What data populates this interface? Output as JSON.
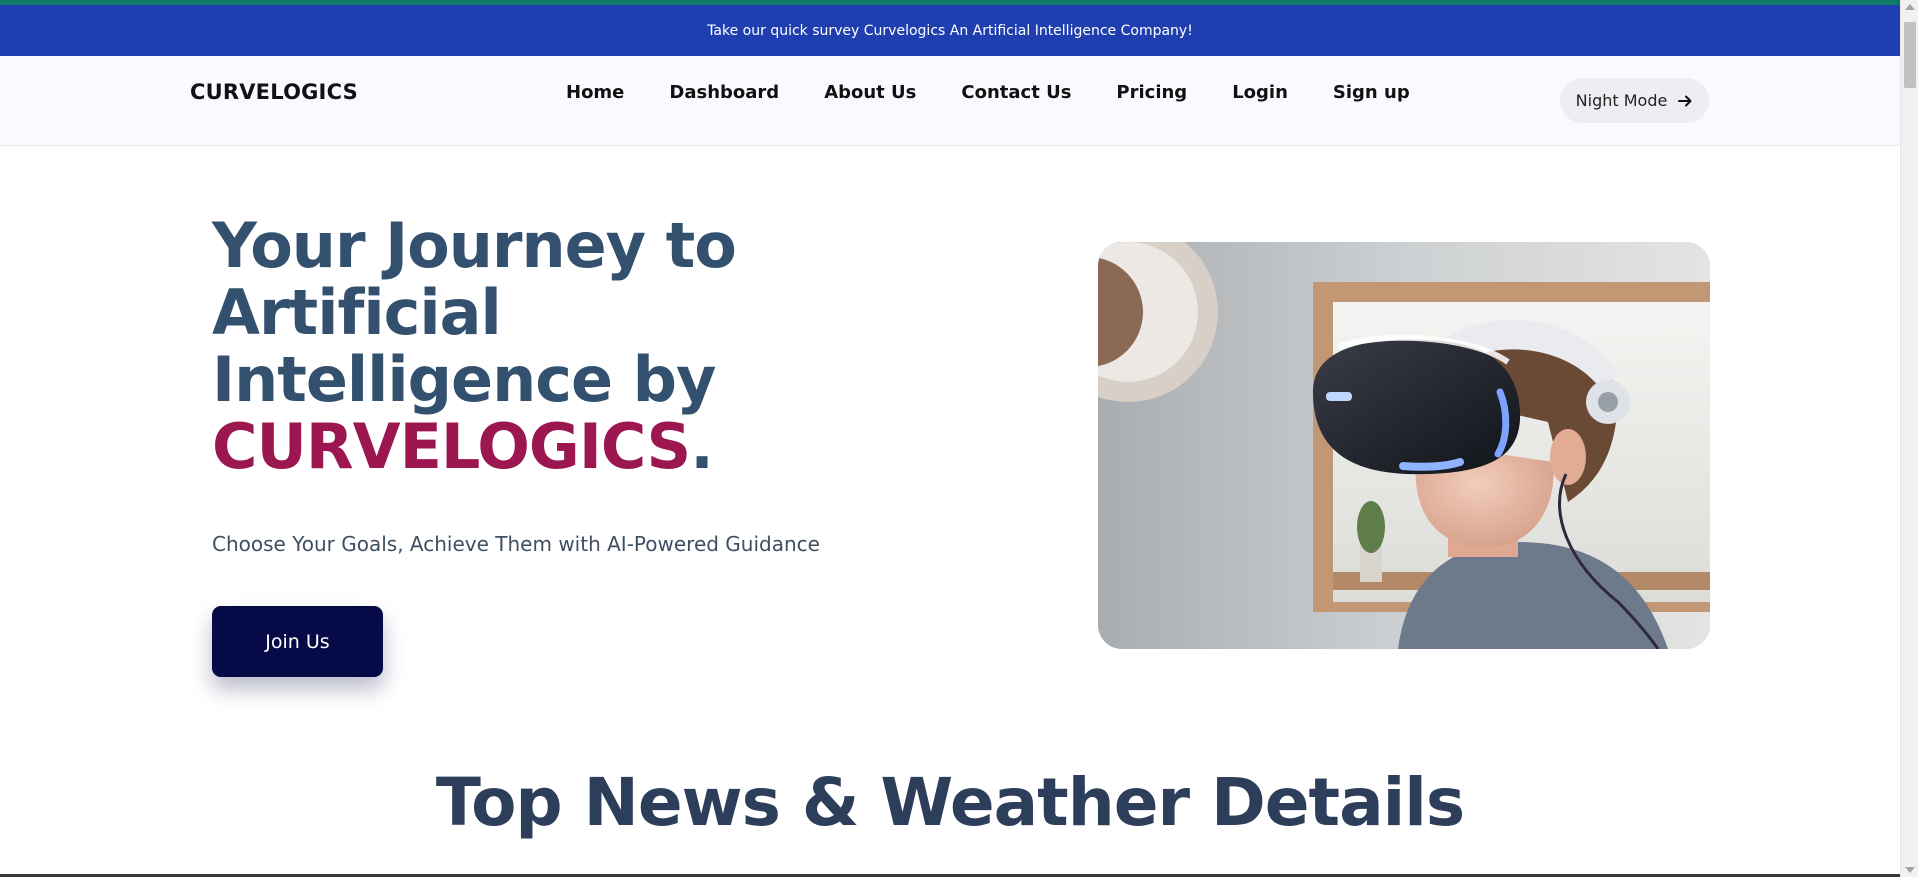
{
  "announcement": {
    "text": "Take our quick survey Curvelogics An Artificial Intelligence Company!"
  },
  "navbar": {
    "logo": "CURVELOGICS",
    "links": [
      "Home",
      "Dashboard",
      "About Us",
      "Contact Us",
      "Pricing",
      "Login",
      "Sign up"
    ],
    "night_mode_label": "Night Mode",
    "night_mode_icon": "arrow-right-icon"
  },
  "hero": {
    "title_line1": "Your Journey to",
    "title_line2": "Artificial",
    "title_line3": "Intelligence by",
    "title_brand": "CURVELOGICS",
    "title_period": ".",
    "subtitle": "Choose Your Goals, Achieve Them with AI-Powered Guidance",
    "cta_label": "Join Us"
  },
  "section": {
    "title": "Top News & Weather Details"
  },
  "colors": {
    "announce_bg": "#1f3fb0",
    "brand_accent": "#9c1650",
    "heading": "#33506e",
    "cta_bg": "#060b47"
  }
}
